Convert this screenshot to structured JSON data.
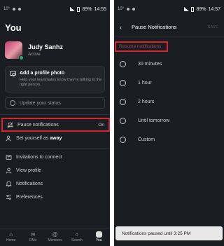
{
  "left": {
    "statusbar": {
      "left": "10°",
      "battery": "89%",
      "time": "14:55"
    },
    "title": "You",
    "profile": {
      "name": "Judy Sanhz",
      "status": "Active"
    },
    "photo_card": {
      "title": "Add a profile photo",
      "subtitle": "Help your teammates know they're talking to the right person."
    },
    "status_placeholder": "Update your status",
    "pause": {
      "label": "Pause notifications",
      "value": "On"
    },
    "away": {
      "prefix": "Set yourself as ",
      "bold": "away"
    },
    "menu": [
      {
        "label": "Invitations to connect",
        "icon": "invitation-icon"
      },
      {
        "label": "View profile",
        "icon": "person-icon"
      },
      {
        "label": "Notifications",
        "icon": "bell-icon"
      },
      {
        "label": "Preferences",
        "icon": "sliders-icon"
      }
    ],
    "tabs": [
      {
        "label": "Home",
        "icon": "home-icon"
      },
      {
        "label": "DMs",
        "icon": "dm-icon"
      },
      {
        "label": "Mentions",
        "icon": "at-icon"
      },
      {
        "label": "Search",
        "icon": "search-icon"
      },
      {
        "label": "You",
        "icon": "avatar-icon",
        "active": true
      }
    ]
  },
  "right": {
    "statusbar": {
      "left": "10°",
      "battery": "89%",
      "time": "14:57"
    },
    "header": {
      "title": "Pause Notifications",
      "save": "SAVE"
    },
    "resume": "Resume notifications",
    "options": [
      "30 minutes",
      "1 hour",
      "2 hours",
      "Until tomorrow",
      "Custom"
    ],
    "toast": "Notifications paused until 3:25 PM"
  },
  "colors": {
    "background": "#1a1d21",
    "highlight": "#d9232e",
    "online": "#2bac76"
  }
}
